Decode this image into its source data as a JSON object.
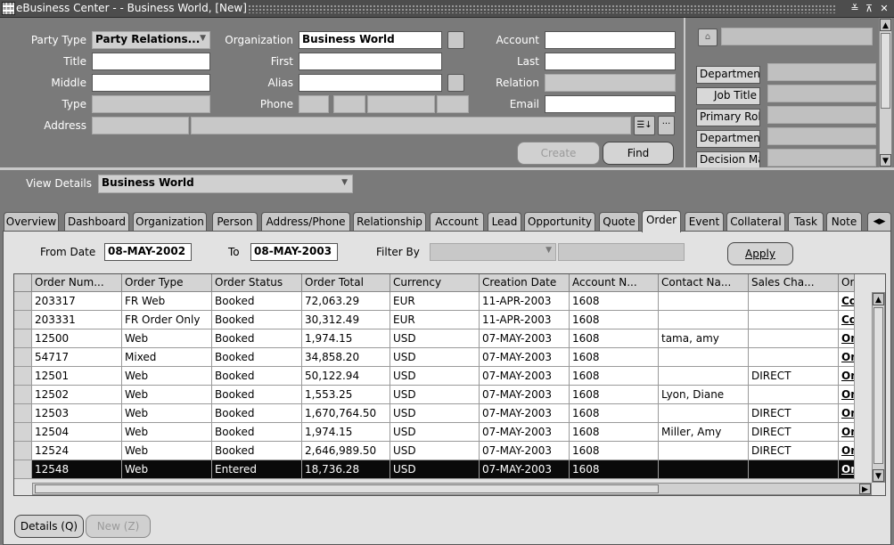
{
  "window": {
    "title": "eBusiness Center -   - Business World, [New]",
    "controls": [
      "≚",
      "⊼",
      "✕"
    ]
  },
  "header": {
    "party_type_label": "Party Type",
    "party_type_value": "Party Relations...",
    "organization_label": "Organization",
    "organization_value": "Business World",
    "account_label": "Account",
    "account_value": "",
    "title_label": "Title",
    "first_label": "First",
    "last_label": "Last",
    "middle_label": "Middle",
    "alias_label": "Alias",
    "relation_label": "Relation",
    "type_label": "Type",
    "phone_label": "Phone",
    "email_label": "Email",
    "address_label": "Address",
    "create_button": "Create",
    "find_button": "Find"
  },
  "right_panel": {
    "fields": [
      "Department",
      "Job Title",
      "Primary Rol",
      "Department",
      "Decision Ma"
    ]
  },
  "view_details": {
    "label": "View Details",
    "value": "Business World"
  },
  "tabs": [
    "Overview",
    "Dashboard",
    "Organization",
    "Person",
    "Address/Phone",
    "Relationship",
    "Account",
    "Lead",
    "Opportunity",
    "Quote",
    "Order",
    "Event",
    "Collateral",
    "Task",
    "Note"
  ],
  "active_tab": "Order",
  "filters": {
    "from_date_label": "From Date",
    "from_date": "08-MAY-2002",
    "to_label": "To",
    "to_date": "08-MAY-2003",
    "filter_by_label": "Filter By",
    "filter_by_value": "",
    "apply_button": "Apply"
  },
  "table": {
    "columns": [
      "Order Num...",
      "Order Type",
      "Order Status",
      "Order Total",
      "Currency",
      "Creation Date",
      "Account N...",
      "Contact Na...",
      "Sales Cha...",
      "Order"
    ],
    "rows": [
      [
        "203317",
        "FR Web",
        "Booked",
        "72,063.29",
        "EUR",
        "11-APR-2003",
        "1608",
        "",
        "",
        "Comr"
      ],
      [
        "203331",
        "FR Order Only",
        "Booked",
        "30,312.49",
        "EUR",
        "11-APR-2003",
        "1608",
        "",
        "",
        "Comr"
      ],
      [
        "12500",
        "Web",
        "Booked",
        "1,974.15",
        "USD",
        "07-MAY-2003",
        "1608",
        "tama, amy",
        "",
        "Onlir"
      ],
      [
        "54717",
        "Mixed",
        "Booked",
        "34,858.20",
        "USD",
        "07-MAY-2003",
        "1608",
        "",
        "",
        "Onlir"
      ],
      [
        "12501",
        "Web",
        "Booked",
        "50,122.94",
        "USD",
        "07-MAY-2003",
        "1608",
        "",
        "DIRECT",
        "Onlir"
      ],
      [
        "12502",
        "Web",
        "Booked",
        "1,553.25",
        "USD",
        "07-MAY-2003",
        "1608",
        "Lyon, Diane",
        "",
        "Onlir"
      ],
      [
        "12503",
        "Web",
        "Booked",
        "1,670,764.50",
        "USD",
        "07-MAY-2003",
        "1608",
        "",
        "DIRECT",
        "Onlir"
      ],
      [
        "12504",
        "Web",
        "Booked",
        "1,974.15",
        "USD",
        "07-MAY-2003",
        "1608",
        "Miller, Amy",
        "DIRECT",
        "Onlir"
      ],
      [
        "12524",
        "Web",
        "Booked",
        "2,646,989.50",
        "USD",
        "07-MAY-2003",
        "1608",
        "",
        "DIRECT",
        "Onlir"
      ],
      [
        "12548",
        "Web",
        "Entered",
        "18,736.28",
        "USD",
        "07-MAY-2003",
        "1608",
        "",
        "",
        "Onlir"
      ]
    ],
    "selected_row": 9
  },
  "footer": {
    "details_button": "Details (Q)",
    "new_button": "New (Z)"
  }
}
